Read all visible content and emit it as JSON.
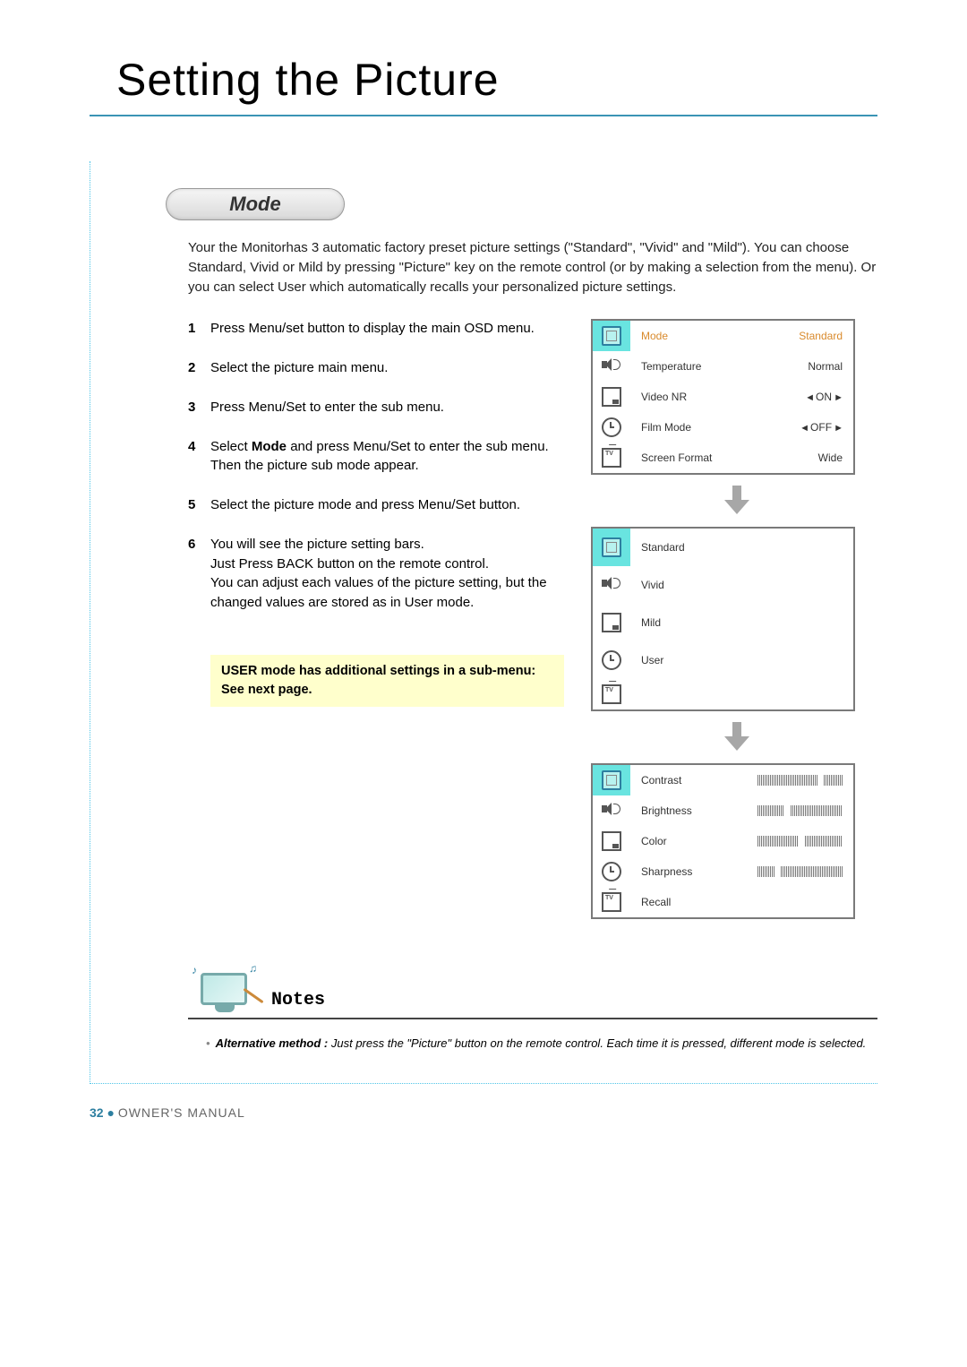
{
  "page_title": "Setting the Picture",
  "section_label": "Mode",
  "intro_text": "Your the Monitorhas 3 automatic factory preset picture settings (\"Standard\", \"Vivid\" and \"Mild\"). You can choose Standard, Vivid or Mild by pressing \"Picture\" key on the remote control (or by making a selection from the menu). Or you can select User which automatically recalls your personalized picture settings.",
  "steps": [
    {
      "n": "1",
      "text": "Press Menu/set button to display the main OSD menu."
    },
    {
      "n": "2",
      "text": "Select the picture main menu."
    },
    {
      "n": "3",
      "text": "Press Menu/Set to enter the sub menu."
    },
    {
      "n": "4",
      "text": "Select Mode and press Menu/Set to enter the sub menu. Then the picture sub mode appear.",
      "bold": "Mode"
    },
    {
      "n": "5",
      "text": "Select the picture mode and press Menu/Set button."
    },
    {
      "n": "6",
      "text": "You will see the picture setting bars.\nJust Press BACK button on the remote control.\nYou can adjust each values of the picture setting, but the changed values are stored as in User mode."
    }
  ],
  "highlight_note": "USER mode has additional settings in a sub-menu: See next page.",
  "osd_main": {
    "rows": [
      {
        "label": "Mode",
        "value": "Standard",
        "highlight": true
      },
      {
        "label": "Temperature",
        "value": "Normal"
      },
      {
        "label": "Video NR",
        "value": "ON",
        "arrows": true
      },
      {
        "label": "Film Mode",
        "value": "OFF",
        "arrows": true
      },
      {
        "label": "Screen Format",
        "value": "Wide"
      }
    ]
  },
  "osd_modes": {
    "rows": [
      {
        "label": "Standard"
      },
      {
        "label": "Vivid"
      },
      {
        "label": "Mild"
      },
      {
        "label": "User"
      }
    ]
  },
  "osd_sliders": {
    "rows": [
      {
        "label": "Contrast",
        "pos": 75
      },
      {
        "label": "Brightness",
        "pos": 35
      },
      {
        "label": "Color",
        "pos": 52
      },
      {
        "label": "Sharpness",
        "pos": 22
      },
      {
        "label": "Recall"
      }
    ]
  },
  "notes": {
    "heading": "Notes",
    "bold_lead": "Alternative method :",
    "text": "Just press the \"Picture\" button on the remote control. Each time it is pressed, different mode is selected."
  },
  "footer": {
    "page": "32",
    "label": "OWNER'S MANUAL"
  }
}
